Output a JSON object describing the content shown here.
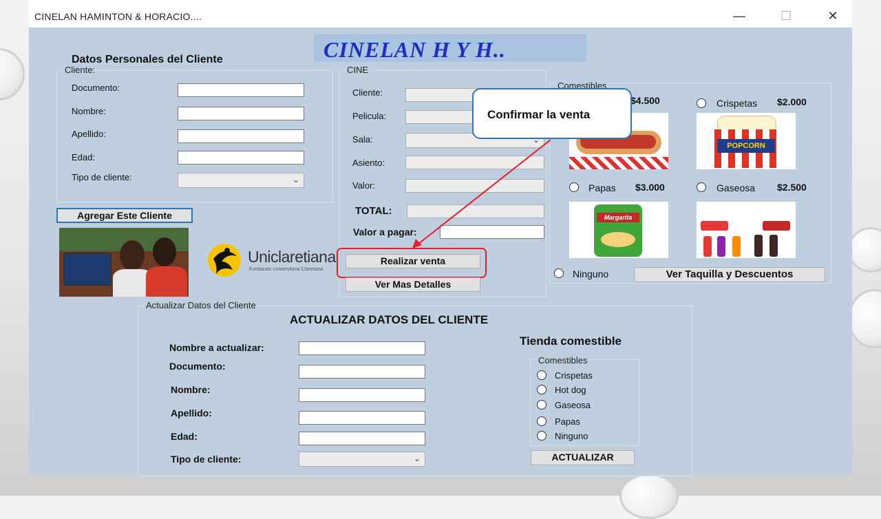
{
  "window": {
    "title": "CINELAN HAMINTON & HORACIO....",
    "minimize": "—",
    "maximize": "☐",
    "close": "✕"
  },
  "banner": {
    "text": "CINELAN H Y H.."
  },
  "personal": {
    "heading": "Datos Personales del Cliente",
    "group_label": "Cliente:",
    "fields": {
      "documento": "Documento:",
      "nombre": "Nombre:",
      "apellido": "Apellido:",
      "edad": "Edad:",
      "tipo": "Tipo de cliente:"
    },
    "values": {
      "documento": "",
      "nombre": "",
      "apellido": "",
      "edad": "",
      "tipo": ""
    },
    "add_button": "Agregar Este Cliente"
  },
  "logo": {
    "name": "Uniclaretiana",
    "tagline": "Fundación Universitaria Claretiana"
  },
  "cine": {
    "group_label": "CINE",
    "fields": {
      "cliente": "Cliente:",
      "pelicula": "Pelicula:",
      "sala": "Sala:",
      "asiento": "Asiento:",
      "valor": "Valor:",
      "total": "TOTAL:",
      "valor_pagar": "Valor a pagar:"
    },
    "realizar": "Realizar venta",
    "detalles": "Ver Mas Detalles"
  },
  "callout": {
    "text": "Confirmar la venta"
  },
  "comestibles": {
    "group_label": "Comestibles",
    "hotdog_price": "$4.500",
    "crispetas": {
      "label": "Crispetas",
      "price": "$2.000"
    },
    "papas": {
      "label": "Papas",
      "price": "$3.000"
    },
    "gaseosa": {
      "label": "Gaseosa",
      "price": "$2.500"
    },
    "ninguno": "Ninguno",
    "taquilla_button": "Ver Taquilla  y Descuentos",
    "popcorn_text": "POPCORN",
    "chips_brand": "Margarita"
  },
  "update": {
    "group_label": "Actualizar Datos del Cliente",
    "heading": "ACTUALIZAR DATOS DEL CLIENTE",
    "fields": {
      "nombre_act": "Nombre a actualizar:",
      "documento": "Documento:",
      "nombre": "Nombre:",
      "apellido": "Apellido:",
      "edad": "Edad:",
      "tipo": "Tipo de cliente:"
    },
    "tienda": "Tienda comestible",
    "comestibles_label": "Comestibles",
    "options": [
      "Crispetas",
      "Hot dog",
      "Gaseosa",
      "Papas",
      "Ninguno"
    ],
    "actualizar": "ACTUALIZAR"
  },
  "colors": {
    "form_bg": "#bfcfdf",
    "banner_bg": "#a9c3e0",
    "banner_text": "#1c2fbf",
    "highlight": "#e0202a",
    "callout_border": "#2e75b6"
  }
}
